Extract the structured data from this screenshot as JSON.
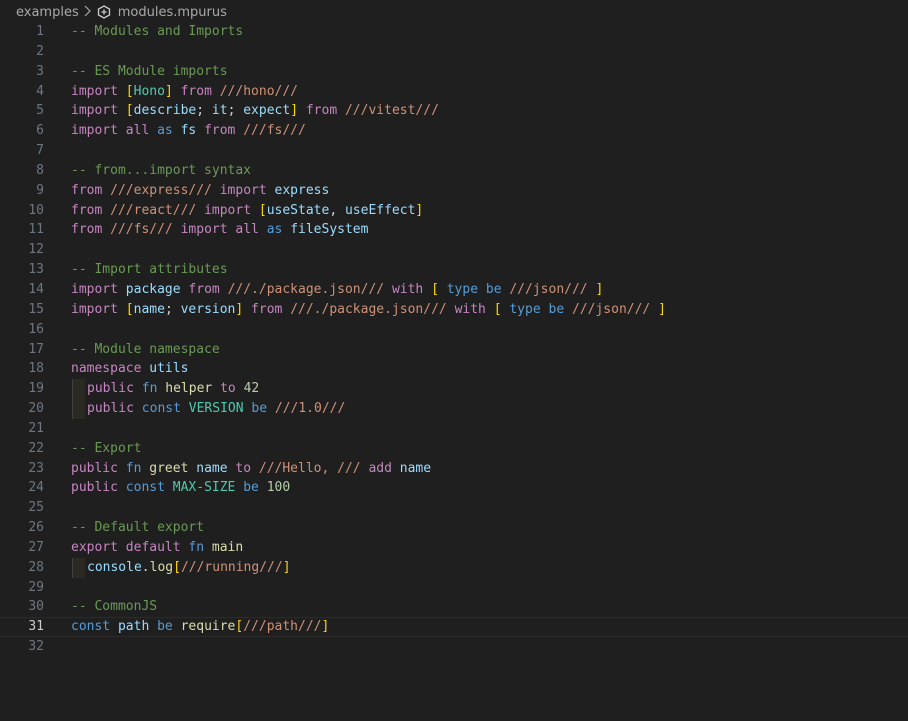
{
  "breadcrumb": {
    "folder": "examples",
    "file": "modules.mpurus"
  },
  "icons": {
    "chevron": "chevron-right-icon",
    "file": "mpurus-file-icon"
  },
  "colors": {
    "background": "#1f1f1f",
    "comment": "#6a9955",
    "keyword": "#c586c0",
    "storage": "#569cd6",
    "identifier": "#9cdcfe",
    "type": "#4ec9b0",
    "string": "#ce9178",
    "number": "#b5cea8",
    "function": "#dcdcaa",
    "bracket": "#ffd700"
  },
  "editor": {
    "current_line": 31,
    "lines": [
      {
        "n": "1",
        "tokens": [
          [
            "c",
            "-- Modules and Imports"
          ]
        ]
      },
      {
        "n": "2",
        "tokens": []
      },
      {
        "n": "3",
        "tokens": [
          [
            "c",
            "-- ES Module imports"
          ]
        ]
      },
      {
        "n": "4",
        "tokens": [
          [
            "k",
            "import"
          ],
          [
            "p",
            " "
          ],
          [
            "b",
            "["
          ],
          [
            "t",
            "Hono"
          ],
          [
            "b",
            "]"
          ],
          [
            "p",
            " "
          ],
          [
            "k",
            "from"
          ],
          [
            "p",
            " "
          ],
          [
            "s",
            "///hono///"
          ]
        ]
      },
      {
        "n": "5",
        "tokens": [
          [
            "k",
            "import"
          ],
          [
            "p",
            " "
          ],
          [
            "b",
            "["
          ],
          [
            "i",
            "describe"
          ],
          [
            "p",
            "; "
          ],
          [
            "i",
            "it"
          ],
          [
            "p",
            "; "
          ],
          [
            "i",
            "expect"
          ],
          [
            "b",
            "]"
          ],
          [
            "p",
            " "
          ],
          [
            "k",
            "from"
          ],
          [
            "p",
            " "
          ],
          [
            "s",
            "///vitest///"
          ]
        ]
      },
      {
        "n": "6",
        "tokens": [
          [
            "k",
            "import"
          ],
          [
            "p",
            " "
          ],
          [
            "k",
            "all"
          ],
          [
            "p",
            " "
          ],
          [
            "v",
            "as"
          ],
          [
            "p",
            " "
          ],
          [
            "i",
            "fs"
          ],
          [
            "p",
            " "
          ],
          [
            "k",
            "from"
          ],
          [
            "p",
            " "
          ],
          [
            "s",
            "///fs///"
          ]
        ]
      },
      {
        "n": "7",
        "tokens": []
      },
      {
        "n": "8",
        "tokens": [
          [
            "c",
            "-- from...import syntax"
          ]
        ]
      },
      {
        "n": "9",
        "tokens": [
          [
            "k",
            "from"
          ],
          [
            "p",
            " "
          ],
          [
            "s",
            "///express///"
          ],
          [
            "p",
            " "
          ],
          [
            "k",
            "import"
          ],
          [
            "p",
            " "
          ],
          [
            "i",
            "express"
          ]
        ]
      },
      {
        "n": "10",
        "tokens": [
          [
            "k",
            "from"
          ],
          [
            "p",
            " "
          ],
          [
            "s",
            "///react///"
          ],
          [
            "p",
            " "
          ],
          [
            "k",
            "import"
          ],
          [
            "p",
            " "
          ],
          [
            "b",
            "["
          ],
          [
            "i",
            "useState"
          ],
          [
            "p",
            ", "
          ],
          [
            "i",
            "useEffect"
          ],
          [
            "b",
            "]"
          ]
        ]
      },
      {
        "n": "11",
        "tokens": [
          [
            "k",
            "from"
          ],
          [
            "p",
            " "
          ],
          [
            "s",
            "///fs///"
          ],
          [
            "p",
            " "
          ],
          [
            "k",
            "import"
          ],
          [
            "p",
            " "
          ],
          [
            "k",
            "all"
          ],
          [
            "p",
            " "
          ],
          [
            "v",
            "as"
          ],
          [
            "p",
            " "
          ],
          [
            "i",
            "fileSystem"
          ]
        ]
      },
      {
        "n": "12",
        "tokens": []
      },
      {
        "n": "13",
        "tokens": [
          [
            "c",
            "-- Import attributes"
          ]
        ]
      },
      {
        "n": "14",
        "tokens": [
          [
            "k",
            "import"
          ],
          [
            "p",
            " "
          ],
          [
            "i",
            "package"
          ],
          [
            "p",
            " "
          ],
          [
            "k",
            "from"
          ],
          [
            "p",
            " "
          ],
          [
            "s",
            "///./package.json///"
          ],
          [
            "p",
            " "
          ],
          [
            "k",
            "with"
          ],
          [
            "p",
            " "
          ],
          [
            "b",
            "["
          ],
          [
            "p",
            " "
          ],
          [
            "v",
            "type"
          ],
          [
            "p",
            " "
          ],
          [
            "v",
            "be"
          ],
          [
            "p",
            " "
          ],
          [
            "s",
            "///json///"
          ],
          [
            "p",
            " "
          ],
          [
            "b",
            "]"
          ]
        ]
      },
      {
        "n": "15",
        "tokens": [
          [
            "k",
            "import"
          ],
          [
            "p",
            " "
          ],
          [
            "b",
            "["
          ],
          [
            "i",
            "name"
          ],
          [
            "p",
            "; "
          ],
          [
            "i",
            "version"
          ],
          [
            "b",
            "]"
          ],
          [
            "p",
            " "
          ],
          [
            "k",
            "from"
          ],
          [
            "p",
            " "
          ],
          [
            "s",
            "///./package.json///"
          ],
          [
            "p",
            " "
          ],
          [
            "k",
            "with"
          ],
          [
            "p",
            " "
          ],
          [
            "b",
            "["
          ],
          [
            "p",
            " "
          ],
          [
            "v",
            "type"
          ],
          [
            "p",
            " "
          ],
          [
            "v",
            "be"
          ],
          [
            "p",
            " "
          ],
          [
            "s",
            "///json///"
          ],
          [
            "p",
            " "
          ],
          [
            "b",
            "]"
          ]
        ]
      },
      {
        "n": "16",
        "tokens": []
      },
      {
        "n": "17",
        "tokens": [
          [
            "c",
            "-- Module namespace"
          ]
        ]
      },
      {
        "n": "18",
        "tokens": [
          [
            "k",
            "namespace"
          ],
          [
            "p",
            " "
          ],
          [
            "i",
            "utils"
          ]
        ]
      },
      {
        "n": "19",
        "indent": true,
        "tokens": [
          [
            "k",
            "public"
          ],
          [
            "p",
            " "
          ],
          [
            "v",
            "fn"
          ],
          [
            "p",
            " "
          ],
          [
            "f",
            "helper"
          ],
          [
            "p",
            " "
          ],
          [
            "k",
            "to"
          ],
          [
            "p",
            " "
          ],
          [
            "n",
            "42"
          ]
        ]
      },
      {
        "n": "20",
        "indent": true,
        "tokens": [
          [
            "k",
            "public"
          ],
          [
            "p",
            " "
          ],
          [
            "v",
            "const"
          ],
          [
            "p",
            " "
          ],
          [
            "t",
            "VERSION"
          ],
          [
            "p",
            " "
          ],
          [
            "v",
            "be"
          ],
          [
            "p",
            " "
          ],
          [
            "s",
            "///1.0///"
          ]
        ]
      },
      {
        "n": "21",
        "tokens": []
      },
      {
        "n": "22",
        "tokens": [
          [
            "c",
            "-- Export"
          ]
        ]
      },
      {
        "n": "23",
        "tokens": [
          [
            "k",
            "public"
          ],
          [
            "p",
            " "
          ],
          [
            "v",
            "fn"
          ],
          [
            "p",
            " "
          ],
          [
            "f",
            "greet"
          ],
          [
            "p",
            " "
          ],
          [
            "i",
            "name"
          ],
          [
            "p",
            " "
          ],
          [
            "k",
            "to"
          ],
          [
            "p",
            " "
          ],
          [
            "s",
            "///Hello, ///"
          ],
          [
            "p",
            " "
          ],
          [
            "k",
            "add"
          ],
          [
            "p",
            " "
          ],
          [
            "i",
            "name"
          ]
        ]
      },
      {
        "n": "24",
        "tokens": [
          [
            "k",
            "public"
          ],
          [
            "p",
            " "
          ],
          [
            "v",
            "const"
          ],
          [
            "p",
            " "
          ],
          [
            "t",
            "MAX-SIZE"
          ],
          [
            "p",
            " "
          ],
          [
            "v",
            "be"
          ],
          [
            "p",
            " "
          ],
          [
            "n",
            "100"
          ]
        ]
      },
      {
        "n": "25",
        "tokens": []
      },
      {
        "n": "26",
        "tokens": [
          [
            "c",
            "-- Default export"
          ]
        ]
      },
      {
        "n": "27",
        "tokens": [
          [
            "k",
            "export"
          ],
          [
            "p",
            " "
          ],
          [
            "k",
            "default"
          ],
          [
            "p",
            " "
          ],
          [
            "v",
            "fn"
          ],
          [
            "p",
            " "
          ],
          [
            "f",
            "main"
          ]
        ]
      },
      {
        "n": "28",
        "indent": true,
        "tokens": [
          [
            "i",
            "console"
          ],
          [
            "p",
            "."
          ],
          [
            "f",
            "log"
          ],
          [
            "b",
            "["
          ],
          [
            "s",
            "///running///"
          ],
          [
            "b",
            "]"
          ]
        ]
      },
      {
        "n": "29",
        "tokens": []
      },
      {
        "n": "30",
        "tokens": [
          [
            "c",
            "-- CommonJS"
          ]
        ]
      },
      {
        "n": "31",
        "tokens": [
          [
            "v",
            "const"
          ],
          [
            "p",
            " "
          ],
          [
            "i",
            "path"
          ],
          [
            "p",
            " "
          ],
          [
            "v",
            "be"
          ],
          [
            "p",
            " "
          ],
          [
            "f",
            "require"
          ],
          [
            "b",
            "["
          ],
          [
            "s",
            "///path///"
          ],
          [
            "b",
            "]"
          ]
        ]
      },
      {
        "n": "32",
        "tokens": []
      }
    ]
  }
}
